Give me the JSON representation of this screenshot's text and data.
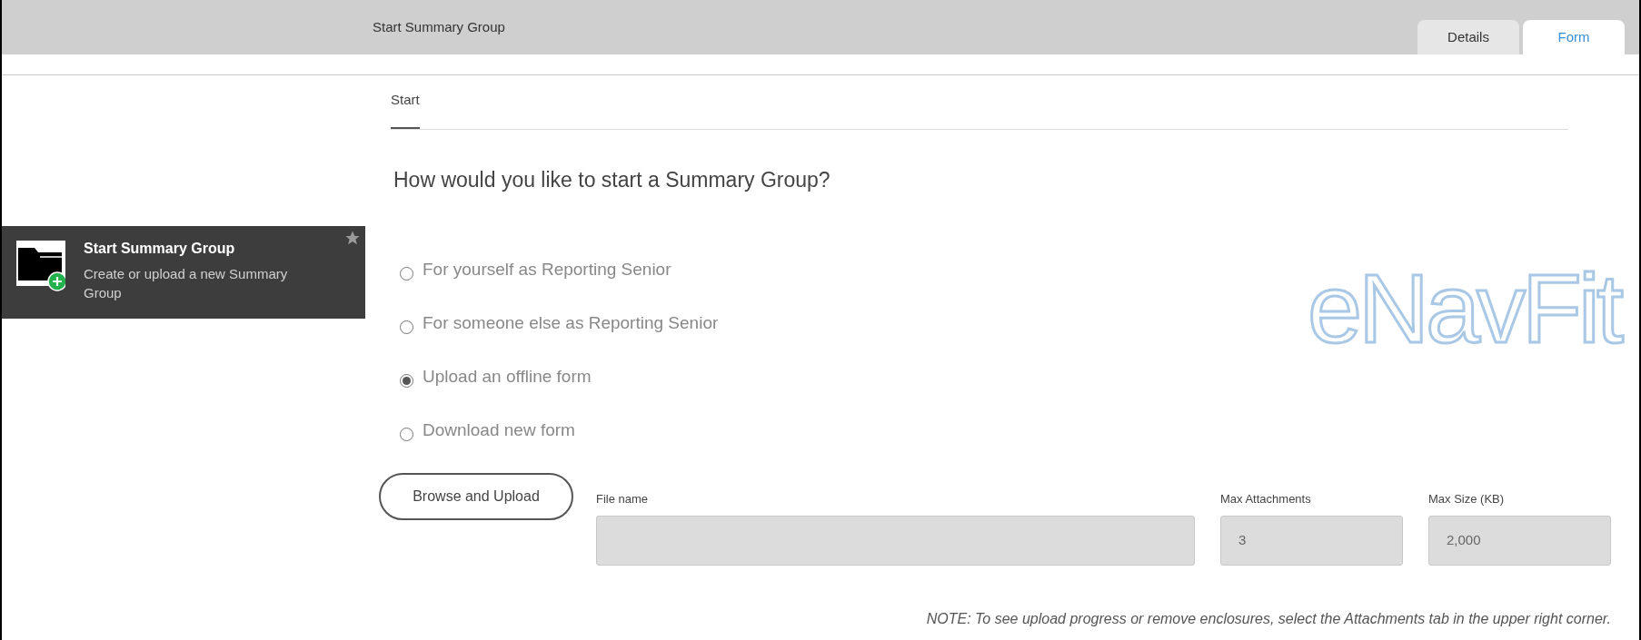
{
  "header": {
    "title": "Start Summary Group",
    "tabs": [
      {
        "label": "Details",
        "selected": false
      },
      {
        "label": "Form",
        "selected": true
      }
    ]
  },
  "sidebar": {
    "items": [
      {
        "title": "Start Summary Group",
        "description": "Create or upload a new Summary Group",
        "selected": true
      }
    ]
  },
  "subtabs": [
    {
      "label": "Start",
      "selected": true
    }
  ],
  "heading": "How would you like to start a Summary Group?",
  "options": [
    {
      "label": "For yourself as Reporting Senior",
      "selected": false
    },
    {
      "label": "For someone else as Reporting Senior",
      "selected": false
    },
    {
      "label": "Upload an offline form",
      "selected": true
    },
    {
      "label": "Download new form",
      "selected": false
    }
  ],
  "logo": "eNavFit",
  "upload": {
    "button": "Browse and Upload",
    "fields": [
      {
        "label": "File name"
      },
      {
        "label": "Max Attachments",
        "value": "3"
      },
      {
        "label": "Max Size (KB)",
        "value": "2,000"
      }
    ]
  },
  "note": "NOTE: To see upload progress or remove enclosures, select the Attachments tab in the upper right corner."
}
